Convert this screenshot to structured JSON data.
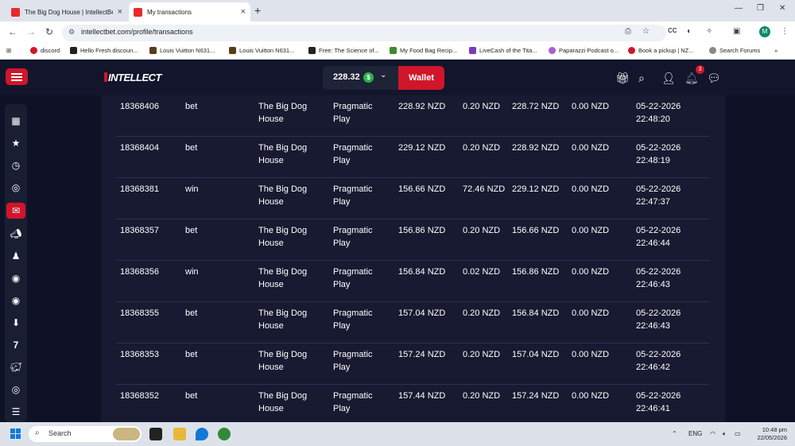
{
  "browser": {
    "tabs": [
      {
        "title": "The Big Dog House | IntellectBe",
        "active": false
      },
      {
        "title": "My transactions",
        "active": true
      }
    ],
    "url": "intellectbet.com/profile/transactions",
    "bookmarks": [
      "discord",
      "Hello Fresh discoun...",
      "Louis Vuitton N631...",
      "Louis Vuitton N631...",
      "Free: The Science of...",
      "My Food Bag Recip...",
      "LiveCash of the Tita...",
      "Paparazzi Podcast o...",
      "Book a pickup | NZ...",
      "Search Forums"
    ],
    "profile_initial": "M"
  },
  "header": {
    "logo": "INTELLECT",
    "balance": "228.32",
    "coin_symbol": "$",
    "wallet_label": "Wallet",
    "notification_count": "3"
  },
  "colors": {
    "accent": "#d0162a",
    "background": "#0f1226",
    "panel": "#171a31",
    "coin": "#2bb44a"
  },
  "transactions": [
    {
      "id": "18368406",
      "type": "bet",
      "game": "The Big Dog House",
      "provider": "Pragmatic Play",
      "before": "228.92 NZD",
      "amount": "0.20 NZD",
      "after": "228.72 NZD",
      "bonus": "0.00 NZD",
      "date": "05-22-2026",
      "time": "22:48:20"
    },
    {
      "id": "18368404",
      "type": "bet",
      "game": "The Big Dog House",
      "provider": "Pragmatic Play",
      "before": "229.12 NZD",
      "amount": "0.20 NZD",
      "after": "228.92 NZD",
      "bonus": "0.00 NZD",
      "date": "05-22-2026",
      "time": "22:48:19"
    },
    {
      "id": "18368381",
      "type": "win",
      "game": "The Big Dog House",
      "provider": "Pragmatic Play",
      "before": "156.66 NZD",
      "amount": "72.46 NZD",
      "after": "229.12 NZD",
      "bonus": "0.00 NZD",
      "date": "05-22-2026",
      "time": "22:47:37"
    },
    {
      "id": "18368357",
      "type": "bet",
      "game": "The Big Dog House",
      "provider": "Pragmatic Play",
      "before": "156.86 NZD",
      "amount": "0.20 NZD",
      "after": "156.66 NZD",
      "bonus": "0.00 NZD",
      "date": "05-22-2026",
      "time": "22:46:44"
    },
    {
      "id": "18368356",
      "type": "win",
      "game": "The Big Dog House",
      "provider": "Pragmatic Play",
      "before": "156.84 NZD",
      "amount": "0.02 NZD",
      "after": "156.86 NZD",
      "bonus": "0.00 NZD",
      "date": "05-22-2026",
      "time": "22:46:43"
    },
    {
      "id": "18368355",
      "type": "bet",
      "game": "The Big Dog House",
      "provider": "Pragmatic Play",
      "before": "157.04 NZD",
      "amount": "0.20 NZD",
      "after": "156.84 NZD",
      "bonus": "0.00 NZD",
      "date": "05-22-2026",
      "time": "22:46:43"
    },
    {
      "id": "18368353",
      "type": "bet",
      "game": "The Big Dog House",
      "provider": "Pragmatic Play",
      "before": "157.24 NZD",
      "amount": "0.20 NZD",
      "after": "157.04 NZD",
      "bonus": "0.00 NZD",
      "date": "05-22-2026",
      "time": "22:46:42"
    },
    {
      "id": "18368352",
      "type": "bet",
      "game": "The Big Dog House",
      "provider": "Pragmatic Play",
      "before": "157.44 NZD",
      "amount": "0.20 NZD",
      "after": "157.24 NZD",
      "bonus": "0.00 NZD",
      "date": "05-22-2026",
      "time": "22:46:41"
    }
  ],
  "taskbar": {
    "search_placeholder": "Search",
    "language": "ENG",
    "time": "10:48 pm",
    "date": "22/05/2026"
  }
}
